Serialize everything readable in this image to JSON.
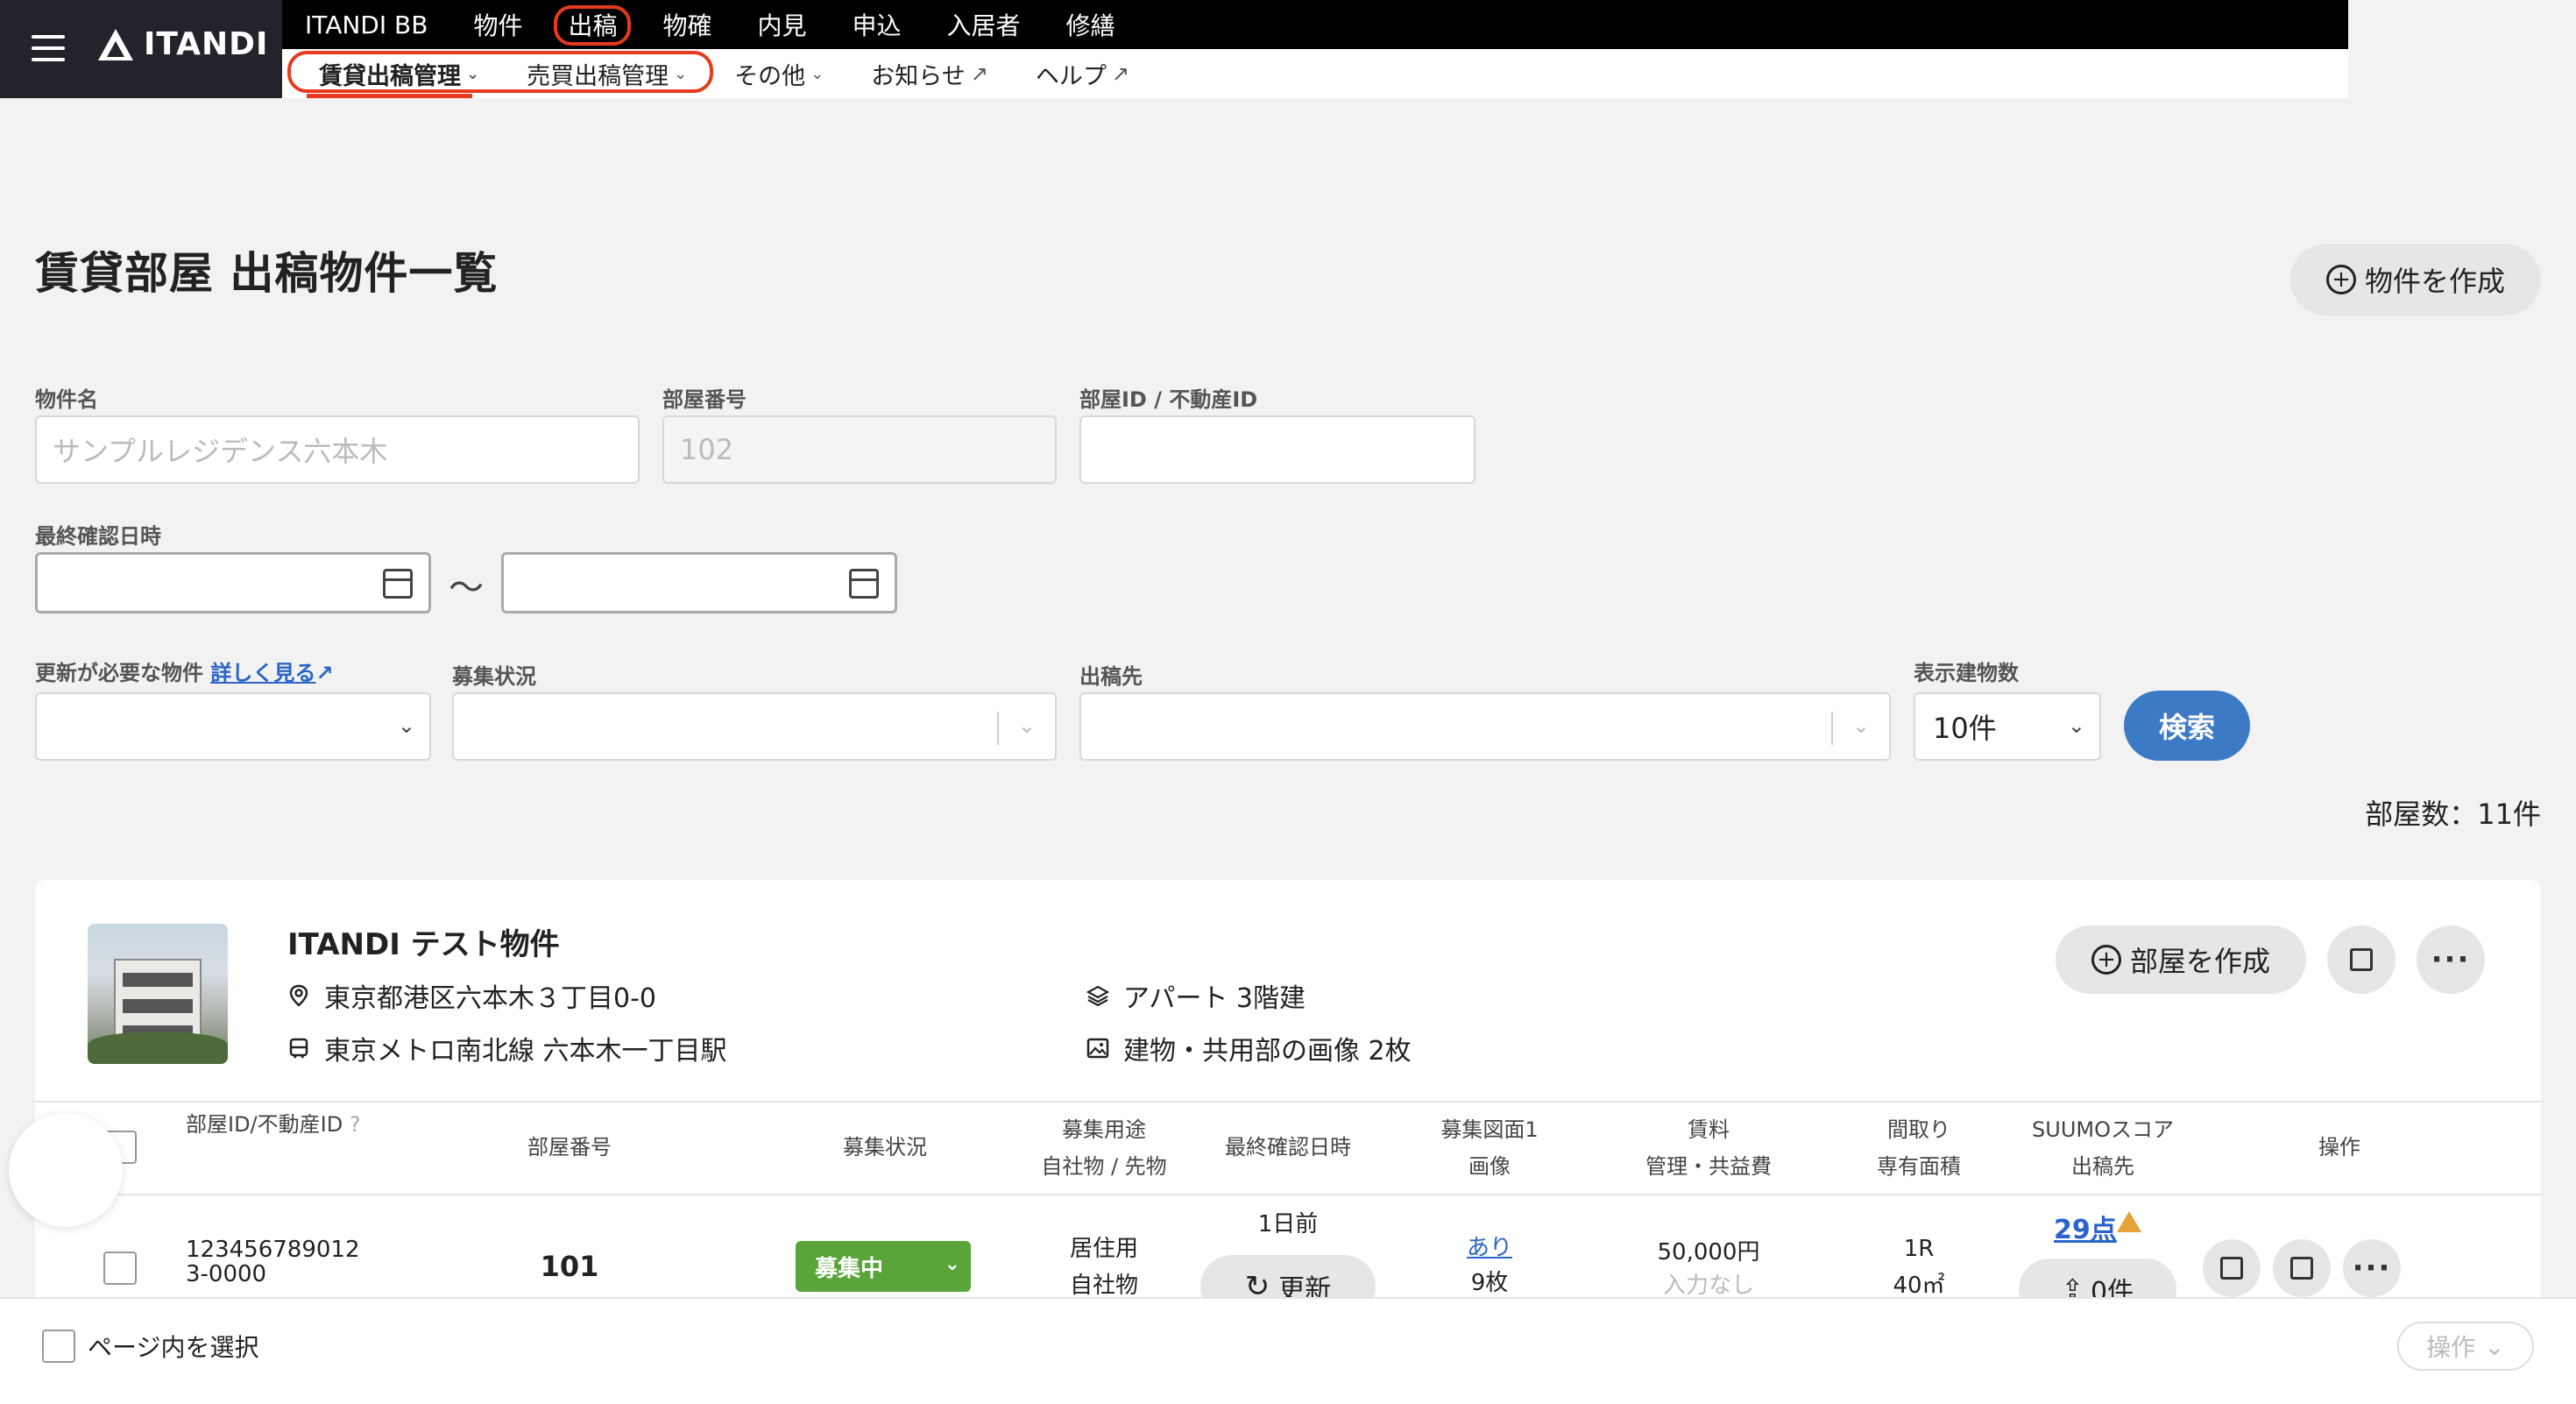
{
  "brand": "ITANDI",
  "main_nav": [
    "ITANDI BB",
    "物件",
    "出稿",
    "物確",
    "内見",
    "申込",
    "入居者",
    "修繕"
  ],
  "sub_nav": [
    "賃貸出稿管理",
    "売買出稿管理",
    "その他",
    "お知らせ",
    "ヘルプ"
  ],
  "page": {
    "title": "賃貸部屋 出稿物件一覧",
    "create_button": "物件を作成"
  },
  "filters": {
    "property_name_label": "物件名",
    "property_name_placeholder": "サンプルレジデンス六本木",
    "room_number_label": "部屋番号",
    "room_number_placeholder": "102",
    "room_id_label": "部屋ID / 不動産ID",
    "last_confirmed_label": "最終確認日時",
    "tilde": "〜",
    "needs_update_label": "更新が必要な物件",
    "details_link": "詳しく見る",
    "recruit_status_label": "募集状況",
    "publish_to_label": "出稿先",
    "display_count_label": "表示建物数",
    "display_count_value": "10件",
    "search_button": "検索"
  },
  "room_count": "部屋数：11件",
  "property": {
    "name": "ITANDI テスト物件",
    "address": "東京都港区六本木３丁目0-0",
    "station": "東京メトロ南北線 六本木一丁目駅",
    "building_type": "アパート 3階建",
    "images": "建物・共用部の画像 2枚",
    "create_room_button": "部屋を作成"
  },
  "table": {
    "headers": {
      "room_id": "部屋ID/不動産ID",
      "room_no": "部屋番号",
      "status": "募集状況",
      "usage_1": "募集用途",
      "usage_2": "自社物 / 先物",
      "last_confirmed": "最終確認日時",
      "floorplan_1": "募集図面1",
      "floorplan_2": "画像",
      "rent_1": "賃料",
      "rent_2": "管理・共益費",
      "layout_1": "間取り",
      "layout_2": "専有面積",
      "suumo_1": "SUUMOスコア",
      "suumo_2": "出稿先",
      "ops": "操作"
    },
    "rows": [
      {
        "room_id_1": "123456789012",
        "room_id_2": "3-0000",
        "room_no": "101",
        "status": "募集中",
        "usage": "居住用",
        "ownership": "自社物",
        "last_confirmed": "1日前",
        "refresh": "更新",
        "floorplan": "あり",
        "images": "9枚",
        "rent": "50,000円",
        "fee": "入力なし",
        "layout": "1R",
        "area": "40㎡",
        "suumo_score": "29点",
        "publish_count": "0件"
      }
    ]
  },
  "footer": {
    "select_page": "ページ内を選択",
    "operations": "操作"
  }
}
